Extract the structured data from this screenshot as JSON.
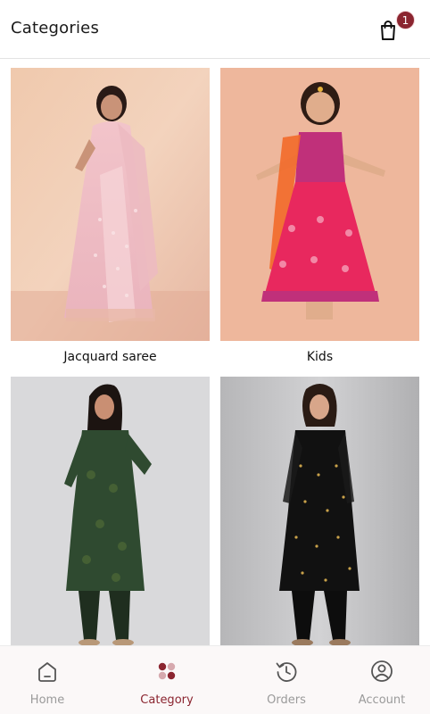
{
  "header": {
    "title": "Categories",
    "cart_badge": "1"
  },
  "categories": [
    {
      "label": "Jacquard saree"
    },
    {
      "label": "Kids"
    },
    {
      "label": ""
    },
    {
      "label": ""
    }
  ],
  "bottom_nav": {
    "items": [
      {
        "label": "Home",
        "icon": "home-icon"
      },
      {
        "label": "Category",
        "icon": "category-icon",
        "active": true
      },
      {
        "label": "Orders",
        "icon": "orders-history-icon"
      },
      {
        "label": "Account",
        "icon": "account-icon"
      }
    ]
  },
  "colors": {
    "accent": "#8b2530",
    "inactive": "#9a9a9a",
    "nav_bg": "#fbf8f8"
  }
}
